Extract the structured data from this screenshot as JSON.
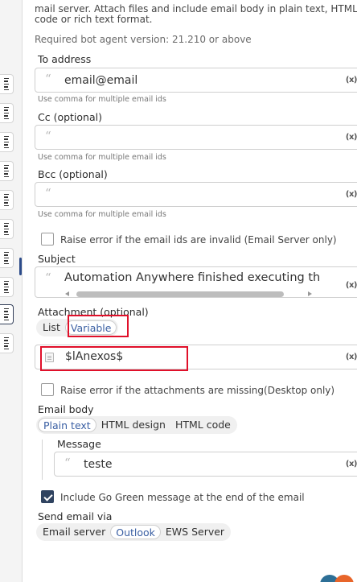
{
  "intro_text": "mail server. Attach files and include email body in plain text, HTML code or rich text format.",
  "required_version": "Required bot agent version: 21.210 or above",
  "to": {
    "label": "To address",
    "value": "email@email",
    "hint": "Use comma for multiple email ids",
    "clear": "(x)"
  },
  "cc": {
    "label": "Cc (optional)",
    "value": "",
    "hint": "Use comma for multiple email ids",
    "clear": "(x)"
  },
  "bcc": {
    "label": "Bcc (optional)",
    "value": "",
    "hint": "Use comma for multiple email ids",
    "clear": "(x)"
  },
  "raise_invalid": {
    "label": "Raise error if the email ids are invalid (Email Server only)",
    "checked": false
  },
  "subject": {
    "label": "Subject",
    "value": "Automation Anywhere finished executing the Task",
    "clear": "(x)"
  },
  "attachment": {
    "label": "Attachment (optional)",
    "options": [
      "List",
      "Variable"
    ],
    "selected": "Variable",
    "value": "$lAnexos$",
    "clear": "(x)"
  },
  "raise_missing": {
    "label": "Raise error if the attachments are missing(Desktop only)",
    "checked": false
  },
  "email_body": {
    "label": "Email body",
    "options": [
      "Plain text",
      "HTML design",
      "HTML code"
    ],
    "selected": "Plain text",
    "message_label": "Message",
    "message_value": "teste",
    "clear": "(x)"
  },
  "go_green": {
    "label": "Include Go Green message at the end of the email",
    "checked": true
  },
  "send_via": {
    "label": "Send email via",
    "options": [
      "Email server",
      "Outlook",
      "EWS Server"
    ],
    "selected": "Outlook"
  },
  "colors": {
    "accent": "#3a5fa3",
    "highlight_box": "#e0102a",
    "check_on": "#2f4360"
  }
}
